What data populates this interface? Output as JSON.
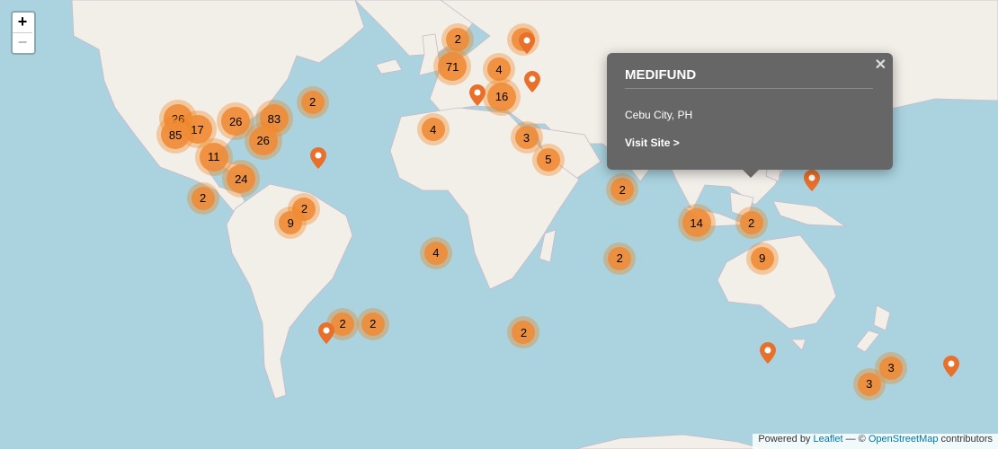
{
  "zoom": {
    "in_label": "+",
    "out_label": "−"
  },
  "clusters": [
    {
      "count": "26",
      "lon": -117,
      "lat": 38
    },
    {
      "count": "17",
      "lon": -110,
      "lat": 34
    },
    {
      "count": "85",
      "lon": -118,
      "lat": 32
    },
    {
      "count": "26",
      "lon": -96,
      "lat": 37
    },
    {
      "count": "83",
      "lon": -82,
      "lat": 38
    },
    {
      "count": "26",
      "lon": -86,
      "lat": 30
    },
    {
      "count": "11",
      "lon": -104,
      "lat": 24
    },
    {
      "count": "24",
      "lon": -94,
      "lat": 16
    },
    {
      "count": "2",
      "lon": -68,
      "lat": 44
    },
    {
      "count": "2",
      "lon": -108,
      "lat": 9
    },
    {
      "count": "2",
      "lon": -71,
      "lat": 5
    },
    {
      "count": "9",
      "lon": -76,
      "lat": 0
    },
    {
      "count": "2",
      "lon": -57,
      "lat": -37
    },
    {
      "count": "2",
      "lon": -46,
      "lat": -37
    },
    {
      "count": "2",
      "lon": -15,
      "lat": 67
    },
    {
      "count": "2",
      "lon": 9,
      "lat": 67
    },
    {
      "count": "71",
      "lon": -17,
      "lat": 57
    },
    {
      "count": "4",
      "lon": 0,
      "lat": 56
    },
    {
      "count": "16",
      "lon": 1,
      "lat": 46
    },
    {
      "count": "4",
      "lon": -24,
      "lat": 34
    },
    {
      "count": "3",
      "lon": 10,
      "lat": 31
    },
    {
      "count": "5",
      "lon": 18,
      "lat": 23
    },
    {
      "count": "2",
      "lon": 45,
      "lat": 12
    },
    {
      "count": "4",
      "lon": -23,
      "lat": -11
    },
    {
      "count": "2",
      "lon": 44,
      "lat": -13
    },
    {
      "count": "2",
      "lon": 9,
      "lat": -40
    },
    {
      "count": "14",
      "lon": 72,
      "lat": 0
    },
    {
      "count": "2",
      "lon": 92,
      "lat": 0
    },
    {
      "count": "9",
      "lon": 96,
      "lat": -13
    },
    {
      "count": "3",
      "lon": 143,
      "lat": -53
    },
    {
      "count": "3",
      "lon": 135,
      "lat": -59
    }
  ],
  "pins": [
    {
      "lon": -66,
      "lat": 18
    },
    {
      "lon": -63,
      "lat": -46
    },
    {
      "lon": -8,
      "lat": 41
    },
    {
      "lon": 10,
      "lat": 60
    },
    {
      "lon": 12,
      "lat": 46
    },
    {
      "lon": 114,
      "lat": 10
    },
    {
      "lon": 98,
      "lat": -53
    },
    {
      "lon": 165,
      "lat": -58
    }
  ],
  "popup": {
    "title": "MEDIFUND",
    "location": "Cebu City, PH",
    "link": "Visit Site >",
    "close": "✕"
  },
  "attribution": {
    "prefix": "Powered by ",
    "leaflet": "Leaflet",
    "sep": " — © ",
    "osm": "OpenStreetMap",
    "suffix": " contributors"
  },
  "colors": {
    "water": "#aad3df",
    "land": "#f2efe9",
    "cluster": "#f08c37",
    "pin": "#e8702a",
    "popup": "#666666"
  }
}
